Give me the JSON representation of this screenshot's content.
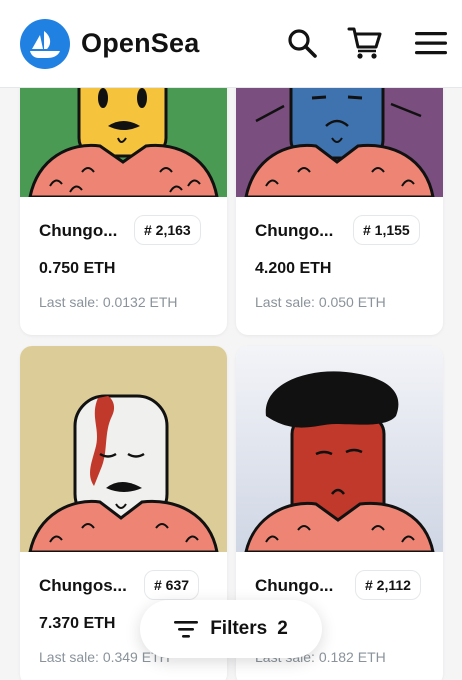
{
  "header": {
    "brand": "OpenSea",
    "icons": [
      "opensea-logo-icon",
      "search-icon",
      "cart-icon",
      "menu-icon"
    ]
  },
  "items": [
    {
      "name": "Chungo...",
      "number": "# 2,163",
      "price": "0.750 ETH",
      "last_sale": "Last sale: 0.0132 ETH",
      "bg": "#4a9a53"
    },
    {
      "name": "Chungo...",
      "number": "# 1,155",
      "price": "4.200 ETH",
      "last_sale": "Last sale: 0.050 ETH",
      "bg": "#7a4e7e"
    },
    {
      "name": "Chungos...",
      "number": "# 637",
      "price": "7.370 ETH",
      "last_sale": "Last sale: 0.349 ETH",
      "bg": "#dccd98"
    },
    {
      "name": "Chungo...",
      "number": "# 2,112",
      "price": "",
      "last_sale": "Last sale: 0.182 ETH",
      "bg": "#e9ecf3"
    }
  ],
  "filters": {
    "label": "Filters",
    "count": "2"
  },
  "colors": {
    "accent": "#2081e2",
    "text": "#121212",
    "muted": "#8a939b",
    "border": "#e5e8eb"
  }
}
